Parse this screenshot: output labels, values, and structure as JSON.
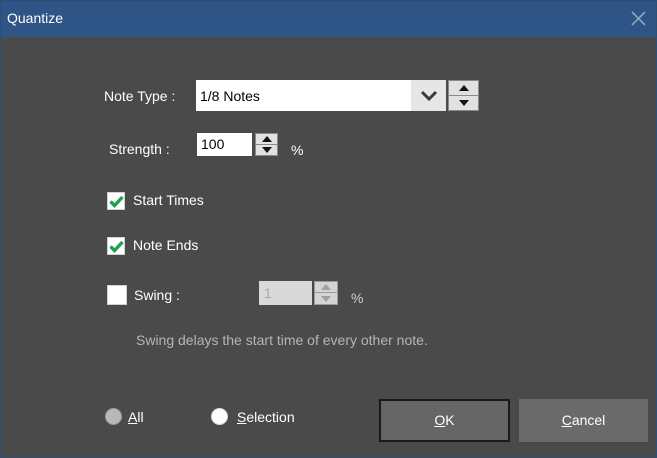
{
  "dialog": {
    "title": "Quantize"
  },
  "note_type": {
    "label": "Note Type :",
    "value": "1/8 Notes"
  },
  "strength": {
    "label": "Strength :",
    "value": "100",
    "unit": "%"
  },
  "options": {
    "start_times": {
      "label": "Start Times",
      "checked": true
    },
    "note_ends": {
      "label": "Note Ends",
      "checked": true
    },
    "swing": {
      "label": "Swing :",
      "checked": false,
      "value": "1",
      "unit": "%"
    }
  },
  "swing_hint": "Swing delays the start time of every other note.",
  "scope": {
    "all": {
      "accel": "A",
      "rest": "ll"
    },
    "selection": {
      "accel": "S",
      "rest": "election"
    }
  },
  "buttons": {
    "ok": {
      "accel": "O",
      "rest": "K"
    },
    "cancel": {
      "accel": "C",
      "rest": "ancel"
    }
  },
  "colors": {
    "titlebar": "#2e5585",
    "background": "#4a4a4a",
    "check": "#1aa34a"
  }
}
